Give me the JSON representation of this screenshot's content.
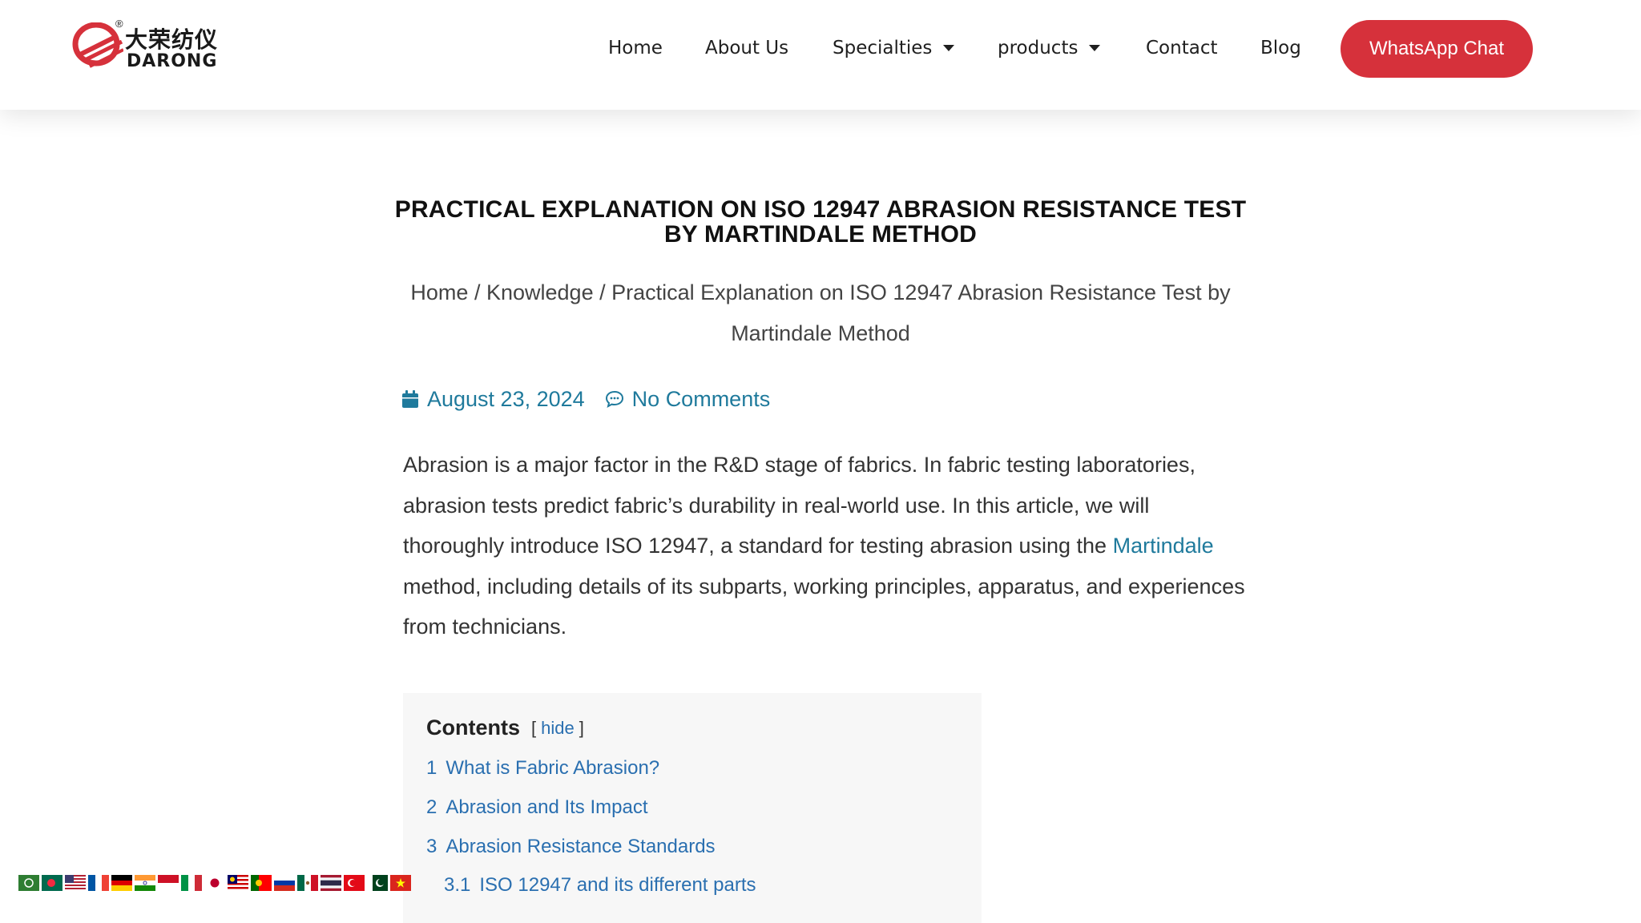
{
  "header": {
    "logo": {
      "cn": "大荣纺仪",
      "en": "DARONG",
      "reg": "®",
      "brand_color": "#d6313b"
    },
    "nav": [
      {
        "label": "Home",
        "has_dropdown": false
      },
      {
        "label": "About Us",
        "has_dropdown": false
      },
      {
        "label": "Specialties",
        "has_dropdown": true
      },
      {
        "label": "products",
        "has_dropdown": true
      },
      {
        "label": "Contact",
        "has_dropdown": false
      },
      {
        "label": "Blog",
        "has_dropdown": false
      }
    ],
    "cta_label": "WhatsApp Chat",
    "cta_color": "#d6313b"
  },
  "article": {
    "title": "PRACTICAL EXPLANATION ON ISO 12947 ABRASION RESISTANCE TEST BY MARTINDALE METHOD",
    "breadcrumb": {
      "home": "Home",
      "sep": "/",
      "section": "Knowledge",
      "current": "Practical Explanation on ISO 12947 Abrasion Resistance Test by Martindale Method"
    },
    "meta": {
      "date": "August 23, 2024",
      "comments": "No Comments",
      "date_icon": "calendar-icon",
      "comments_icon": "comment-icon",
      "link_color": "#1f7a9c"
    },
    "intro": {
      "before_link": "Abrasion is a major factor in the R&D stage of fabrics. In fabric testing laboratories, abrasion tests predict fabric’s durability in real-world use. In this article, we will thoroughly introduce ISO 12947, a standard for testing abrasion using the ",
      "link": "Martindale",
      "after_link": " method, including details of its subparts, working principles, apparatus, and experiences from technicians."
    }
  },
  "toc": {
    "heading": "Contents",
    "toggle_open": "[",
    "toggle_label": "hide",
    "toggle_close": "]",
    "items": [
      {
        "num": "1",
        "label": "What is Fabric Abrasion?"
      },
      {
        "num": "2",
        "label": "Abrasion and Its Impact"
      },
      {
        "num": "3",
        "label": "Abrasion Resistance Standards"
      },
      {
        "num": "3.1",
        "label": "ISO 12947 and its different parts"
      }
    ]
  },
  "language_flags": [
    "flag-arabic",
    "flag-bangladesh",
    "flag-united-states",
    "flag-france",
    "flag-germany",
    "flag-india",
    "flag-indonesia",
    "flag-italy",
    "flag-japan",
    "flag-malaysia",
    "flag-portugal",
    "flag-russia",
    "flag-mexico",
    "flag-thailand",
    "flag-turkey",
    "flag-pakistan",
    "flag-vietnam"
  ]
}
